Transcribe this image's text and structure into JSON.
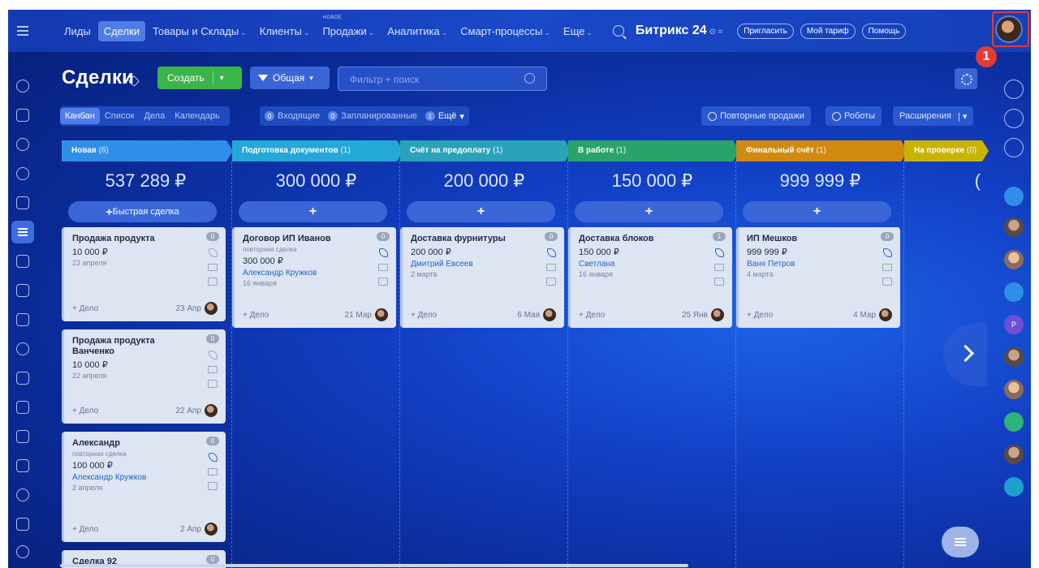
{
  "topbar": {
    "nav": [
      {
        "label": "Лиды",
        "active": false,
        "chevron": false
      },
      {
        "label": "Сделки",
        "active": true,
        "chevron": false
      },
      {
        "label": "Товары и Склады",
        "active": false,
        "chevron": true
      },
      {
        "label": "Клиенты",
        "active": false,
        "chevron": true
      },
      {
        "label": "Продажи",
        "active": false,
        "chevron": true,
        "tag": "НОВОЕ"
      },
      {
        "label": "Аналитика",
        "active": false,
        "chevron": true
      },
      {
        "label": "Смарт-процессы",
        "active": false,
        "chevron": true
      },
      {
        "label": "Еще",
        "active": false,
        "chevron": true
      }
    ],
    "brand": "Битрикс 24",
    "buttons": [
      "Пригласить",
      "Мой тариф",
      "Помощь"
    ],
    "step_badge": "1"
  },
  "page": {
    "title": "Сделки",
    "create_label": "Создать",
    "general_label": "Общая",
    "filter_placeholder": "Фильтр + поиск"
  },
  "view_tabs": [
    "Канбан",
    "Список",
    "Дела",
    "Календарь"
  ],
  "counters": [
    {
      "num": "0",
      "label": "Входящие"
    },
    {
      "num": "0",
      "label": "Запланированные"
    },
    {
      "num": "1",
      "label": "Ещё"
    }
  ],
  "right_buttons": {
    "repeat_sales": "Повторные продажи",
    "robots": "Роботы",
    "extensions": "Расширения"
  },
  "columns": [
    {
      "name": "Новая",
      "count": "(6)",
      "color": "#2f8ee8",
      "sum": "537 289 ₽",
      "quick": "Быстрая сделка",
      "cards": [
        {
          "title": "Продажа продукта",
          "sub": "",
          "price": "10 000 ₽",
          "person": "",
          "date": "23 апреля",
          "deal": "+ Дело",
          "when": "23 Апр",
          "badge": "0"
        },
        {
          "title": "Продажа продукта Ванченко",
          "sub": "",
          "price": "10 000 ₽",
          "person": "",
          "date": "22 апреля",
          "deal": "+ Дело",
          "when": "22 Апр",
          "badge": "0"
        },
        {
          "title": "Александр",
          "sub": "повторная сделка",
          "price": "100 000 ₽",
          "person": "Александр Кружков",
          "date": "2 апреля",
          "deal": "+ Дело",
          "when": "2 Апр",
          "badge": "0"
        },
        {
          "title": "Сделка 92",
          "sub": "",
          "price": "",
          "person": "",
          "date": "",
          "deal": "",
          "when": "",
          "badge": "0"
        }
      ]
    },
    {
      "name": "Подготовка документов",
      "count": "(1)",
      "color": "#23a8d8",
      "sum": "300 000 ₽",
      "quick": "+",
      "cards": [
        {
          "title": "Договор ИП Иванов",
          "sub": "повторная сделка",
          "price": "300 000 ₽",
          "person": "Александр Кружков",
          "date": "16 января",
          "deal": "+ Дело",
          "when": "21 Мар",
          "badge": "0"
        }
      ]
    },
    {
      "name": "Счёт на предоплату",
      "count": "(1)",
      "color": "#2aa3b8",
      "sum": "200 000 ₽",
      "quick": "+",
      "cards": [
        {
          "title": "Доставка фурнитуры",
          "sub": "",
          "price": "200 000 ₽",
          "person": "Дмитрий Евсеев",
          "date": "2 марта",
          "deal": "+ Дело",
          "when": "6 Мая",
          "badge": "0"
        }
      ]
    },
    {
      "name": "В работе",
      "count": "(1)",
      "color": "#2aa36b",
      "sum": "150 000 ₽",
      "quick": "+",
      "cards": [
        {
          "title": "Доставка блоков",
          "sub": "",
          "price": "150 000 ₽",
          "person": "Светлана",
          "date": "16 января",
          "deal": "+ Дело",
          "when": "25 Янв",
          "badge": "1"
        }
      ]
    },
    {
      "name": "Финальный счёт",
      "count": "(1)",
      "color": "#d18a10",
      "sum": "999 999 ₽",
      "quick": "+",
      "cards": [
        {
          "title": "ИП Мешков",
          "sub": "",
          "price": "999 999 ₽",
          "person": "Ваня Петров",
          "date": "4 марта",
          "deal": "+ Дело",
          "when": "4 Мар",
          "badge": "0"
        }
      ]
    },
    {
      "name": "На проверке",
      "count": "(0)",
      "color": "#c8b400",
      "sum": "(",
      "quick": "",
      "cards": []
    }
  ],
  "sidebar_right_labels": [
    "Р"
  ]
}
